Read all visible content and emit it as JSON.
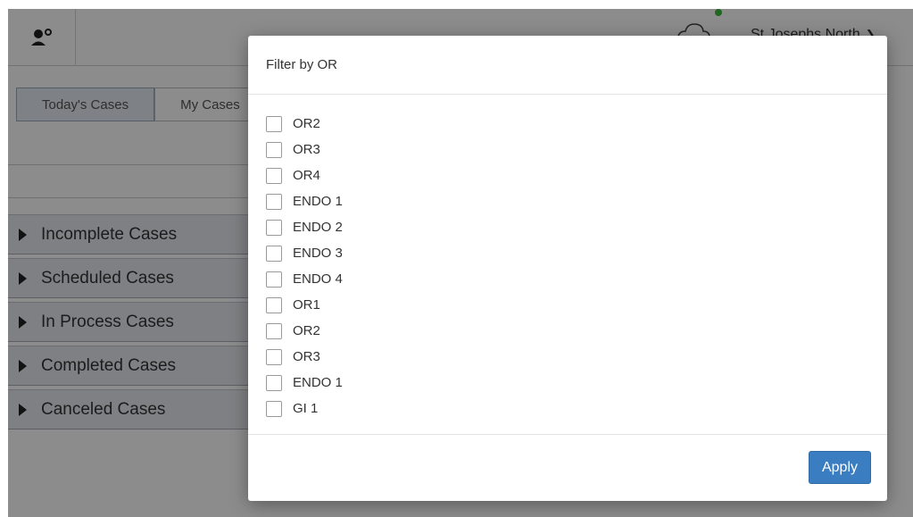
{
  "header": {
    "location": "St Josephs North",
    "status_color": "#3dbb3d"
  },
  "tabs": [
    {
      "label": "Today's Cases"
    },
    {
      "label": "My Cases"
    }
  ],
  "sections": [
    {
      "label": "Incomplete Cases"
    },
    {
      "label": "Scheduled Cases"
    },
    {
      "label": "In Process Cases"
    },
    {
      "label": "Completed Cases"
    },
    {
      "label": "Canceled Cases"
    }
  ],
  "modal": {
    "title": "Filter by OR",
    "options": [
      {
        "label": "OR2",
        "checked": false
      },
      {
        "label": "OR3",
        "checked": false
      },
      {
        "label": "OR4",
        "checked": false
      },
      {
        "label": "ENDO 1",
        "checked": false
      },
      {
        "label": "ENDO 2",
        "checked": false
      },
      {
        "label": "ENDO 3",
        "checked": false
      },
      {
        "label": "ENDO 4",
        "checked": false
      },
      {
        "label": "OR1",
        "checked": false
      },
      {
        "label": "OR2",
        "checked": false
      },
      {
        "label": "OR3",
        "checked": false
      },
      {
        "label": "ENDO 1",
        "checked": false
      },
      {
        "label": "GI 1",
        "checked": false
      }
    ],
    "apply_label": "Apply"
  },
  "colors": {
    "accent": "#3a7dc0",
    "overlay": "rgba(0,0,0,0.45)"
  },
  "icons": {
    "logo": "user-icon",
    "cloud": "cloud-icon",
    "dropdown": "chevron-down-icon",
    "section_toggle": "caret-right-icon"
  }
}
